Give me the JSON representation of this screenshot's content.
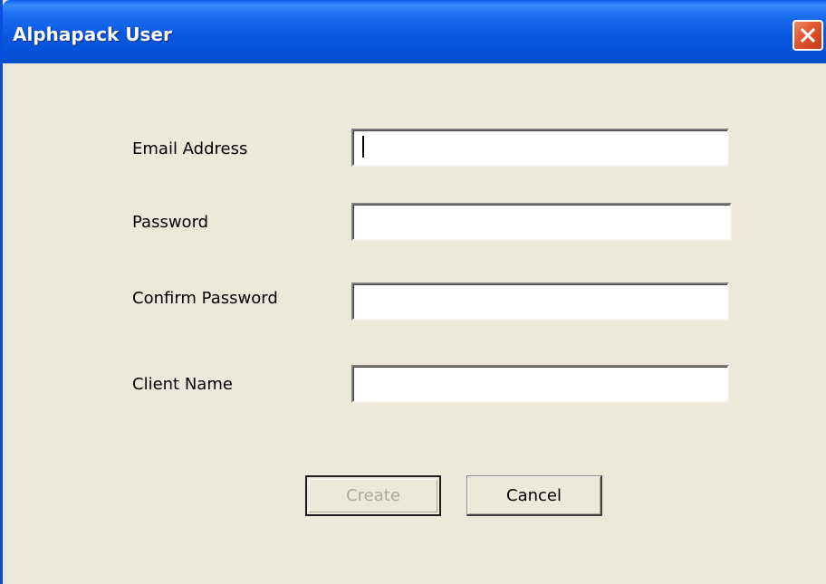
{
  "window": {
    "title": "Alphapack User"
  },
  "form": {
    "fields": [
      {
        "label": "Email Address",
        "value": ""
      },
      {
        "label": "Password",
        "value": ""
      },
      {
        "label": "Confirm Password",
        "value": ""
      },
      {
        "label": "Client Name",
        "value": ""
      }
    ]
  },
  "buttons": {
    "create_label": "Create",
    "cancel_label": "Cancel"
  },
  "icons": {
    "close": "close-icon"
  },
  "colors": {
    "titlebar": "#0a58e0",
    "close_button": "#e0552f",
    "background": "#ece9d8"
  }
}
